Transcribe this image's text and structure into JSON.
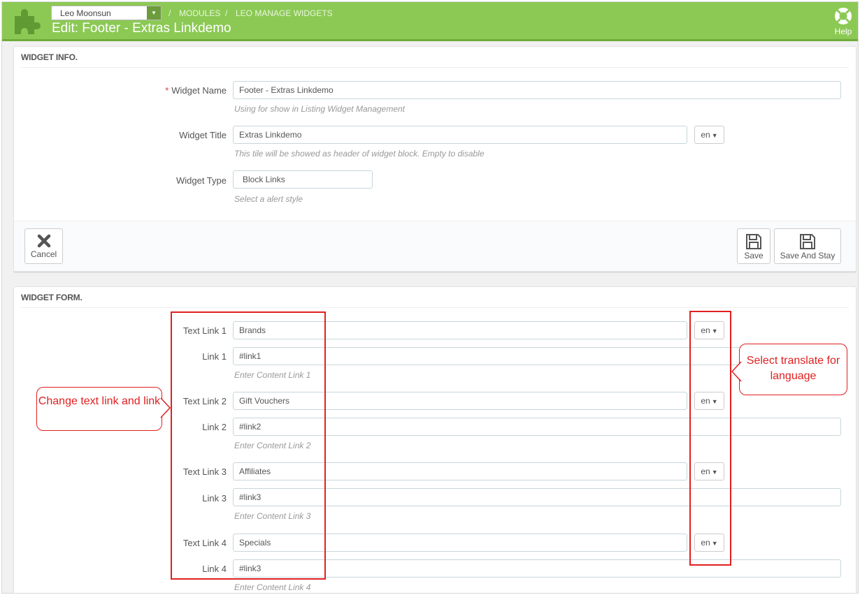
{
  "header": {
    "shop_selector": "Leo Moonsun",
    "breadcrumbs": [
      "MODULES",
      "LEO MANAGE WIDGETS"
    ],
    "title": "Edit: Footer - Extras Linkdemo",
    "help_label": "Help",
    "color": "#8bc954"
  },
  "widget_info": {
    "heading": "WIDGET INFO.",
    "name": {
      "label": "Widget Name",
      "value": "Footer - Extras Linkdemo",
      "hint": "Using for show in Listing Widget Management"
    },
    "title": {
      "label": "Widget Title",
      "value": "Extras Linkdemo",
      "lang": "en",
      "hint": "This tile will be showed as header of widget block. Empty to disable"
    },
    "type": {
      "label": "Widget Type",
      "value": "Block Links",
      "hint": "Select a alert style"
    },
    "buttons": {
      "cancel": "Cancel",
      "save": "Save",
      "save_and_stay": "Save And Stay"
    }
  },
  "widget_form": {
    "heading": "WIDGET FORM.",
    "rows": [
      {
        "text_label": "Text Link 1",
        "text_value": "Brands",
        "lang": "en",
        "link_label": "Link 1",
        "link_value": "#link1",
        "hint": "Enter Content Link 1"
      },
      {
        "text_label": "Text Link 2",
        "text_value": "Gift Vouchers",
        "lang": "en",
        "link_label": "Link 2",
        "link_value": "#link2",
        "hint": "Enter Content Link 2"
      },
      {
        "text_label": "Text Link 3",
        "text_value": "Affiliates",
        "lang": "en",
        "link_label": "Link 3",
        "link_value": "#link3",
        "hint": "Enter Content Link 3"
      },
      {
        "text_label": "Text Link 4",
        "text_value": "Specials",
        "lang": "en",
        "link_label": "Link 4",
        "link_value": "#link3",
        "hint": "Enter Content Link 4"
      }
    ]
  },
  "annotations": {
    "left_callout": "Change text link and link",
    "right_callout": "Select translate for language",
    "color": "#e02020"
  }
}
